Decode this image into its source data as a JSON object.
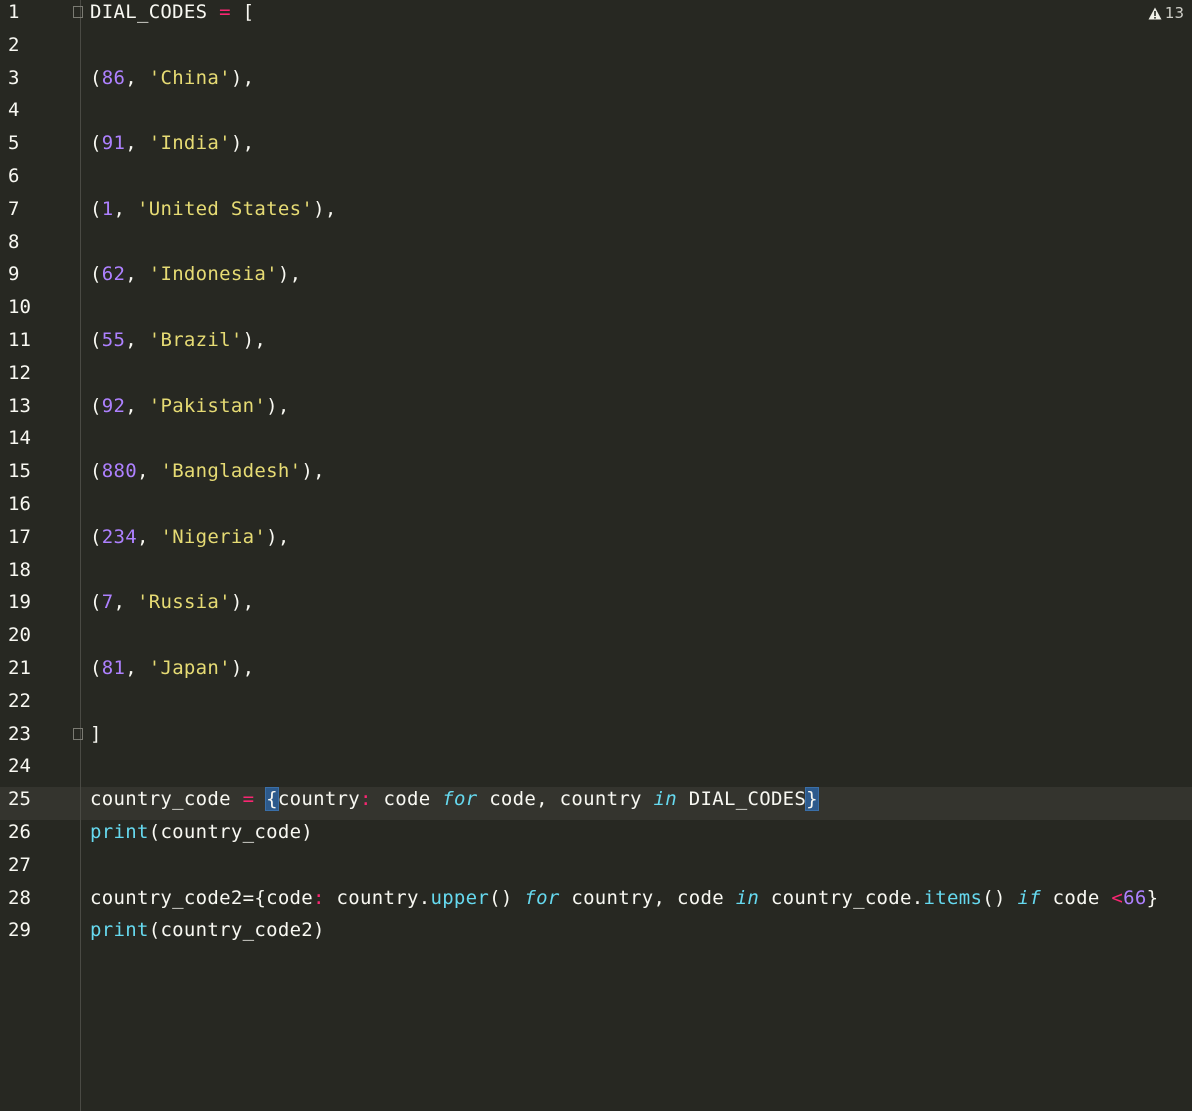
{
  "warnings": {
    "count": "13"
  },
  "lines": [
    {
      "n": "1",
      "tokens": [
        [
          "plain",
          "DIAL_CODES "
        ],
        [
          "op",
          "="
        ],
        [
          "plain",
          " ["
        ]
      ]
    },
    {
      "n": "2",
      "tokens": []
    },
    {
      "n": "3",
      "tokens": [
        [
          "plain",
          "("
        ],
        [
          "num",
          "86"
        ],
        [
          "plain",
          ", "
        ],
        [
          "str",
          "'China'"
        ],
        [
          "plain",
          "),"
        ]
      ]
    },
    {
      "n": "4",
      "tokens": []
    },
    {
      "n": "5",
      "tokens": [
        [
          "plain",
          "("
        ],
        [
          "num",
          "91"
        ],
        [
          "plain",
          ", "
        ],
        [
          "str",
          "'India'"
        ],
        [
          "plain",
          "),"
        ]
      ]
    },
    {
      "n": "6",
      "tokens": []
    },
    {
      "n": "7",
      "tokens": [
        [
          "plain",
          "("
        ],
        [
          "num",
          "1"
        ],
        [
          "plain",
          ", "
        ],
        [
          "str",
          "'United States'"
        ],
        [
          "plain",
          "),"
        ]
      ]
    },
    {
      "n": "8",
      "tokens": []
    },
    {
      "n": "9",
      "tokens": [
        [
          "plain",
          "("
        ],
        [
          "num",
          "62"
        ],
        [
          "plain",
          ", "
        ],
        [
          "str",
          "'Indonesia'"
        ],
        [
          "plain",
          "),"
        ]
      ]
    },
    {
      "n": "10",
      "tokens": []
    },
    {
      "n": "11",
      "tokens": [
        [
          "plain",
          "("
        ],
        [
          "num",
          "55"
        ],
        [
          "plain",
          ", "
        ],
        [
          "str",
          "'Brazil'"
        ],
        [
          "plain",
          "),"
        ]
      ]
    },
    {
      "n": "12",
      "tokens": []
    },
    {
      "n": "13",
      "tokens": [
        [
          "plain",
          "("
        ],
        [
          "num",
          "92"
        ],
        [
          "plain",
          ", "
        ],
        [
          "str",
          "'Pakistan'"
        ],
        [
          "plain",
          "),"
        ]
      ]
    },
    {
      "n": "14",
      "tokens": []
    },
    {
      "n": "15",
      "tokens": [
        [
          "plain",
          "("
        ],
        [
          "num",
          "880"
        ],
        [
          "plain",
          ", "
        ],
        [
          "str",
          "'Bangladesh'"
        ],
        [
          "plain",
          "),"
        ]
      ]
    },
    {
      "n": "16",
      "tokens": []
    },
    {
      "n": "17",
      "tokens": [
        [
          "plain",
          "("
        ],
        [
          "num",
          "234"
        ],
        [
          "plain",
          ", "
        ],
        [
          "str",
          "'Nigeria'"
        ],
        [
          "plain",
          "),"
        ]
      ]
    },
    {
      "n": "18",
      "tokens": []
    },
    {
      "n": "19",
      "tokens": [
        [
          "plain",
          "("
        ],
        [
          "num",
          "7"
        ],
        [
          "plain",
          ", "
        ],
        [
          "str",
          "'Russia'"
        ],
        [
          "plain",
          "),"
        ]
      ]
    },
    {
      "n": "20",
      "tokens": []
    },
    {
      "n": "21",
      "tokens": [
        [
          "plain",
          "("
        ],
        [
          "num",
          "81"
        ],
        [
          "plain",
          ", "
        ],
        [
          "str",
          "'Japan'"
        ],
        [
          "plain",
          "),"
        ]
      ]
    },
    {
      "n": "22",
      "tokens": []
    },
    {
      "n": "23",
      "tokens": [
        [
          "plain",
          "]"
        ]
      ]
    },
    {
      "n": "24",
      "tokens": []
    },
    {
      "n": "25",
      "current": true,
      "tokens": [
        [
          "plain",
          "country_code "
        ],
        [
          "op",
          "="
        ],
        [
          "plain",
          " "
        ],
        [
          "brace",
          "{"
        ],
        [
          "plain",
          "country"
        ],
        [
          "op",
          ":"
        ],
        [
          "plain",
          " code "
        ],
        [
          "kw",
          "for"
        ],
        [
          "plain",
          " code, country "
        ],
        [
          "kw",
          "in"
        ],
        [
          "plain",
          " DIAL_CODES"
        ],
        [
          "brace",
          "}"
        ]
      ]
    },
    {
      "n": "26",
      "tokens": [
        [
          "fn",
          "print"
        ],
        [
          "plain",
          "(country_code)"
        ]
      ]
    },
    {
      "n": "27",
      "tokens": []
    },
    {
      "n": "28",
      "tokens": [
        [
          "plain",
          "country_code2={code"
        ],
        [
          "op",
          ":"
        ],
        [
          "plain",
          " country."
        ],
        [
          "fn",
          "upper"
        ],
        [
          "plain",
          "() "
        ],
        [
          "kw",
          "for"
        ],
        [
          "plain",
          " country, code "
        ],
        [
          "kw",
          "in"
        ],
        [
          "plain",
          " country_code."
        ],
        [
          "fn",
          "items"
        ],
        [
          "plain",
          "() "
        ],
        [
          "kw",
          "if"
        ],
        [
          "plain",
          " code "
        ],
        [
          "op",
          "<"
        ],
        [
          "num",
          "66"
        ],
        [
          "plain",
          "}"
        ]
      ]
    },
    {
      "n": "29",
      "tokens": [
        [
          "fn",
          "print"
        ],
        [
          "plain",
          "(country_code2)"
        ]
      ]
    }
  ]
}
